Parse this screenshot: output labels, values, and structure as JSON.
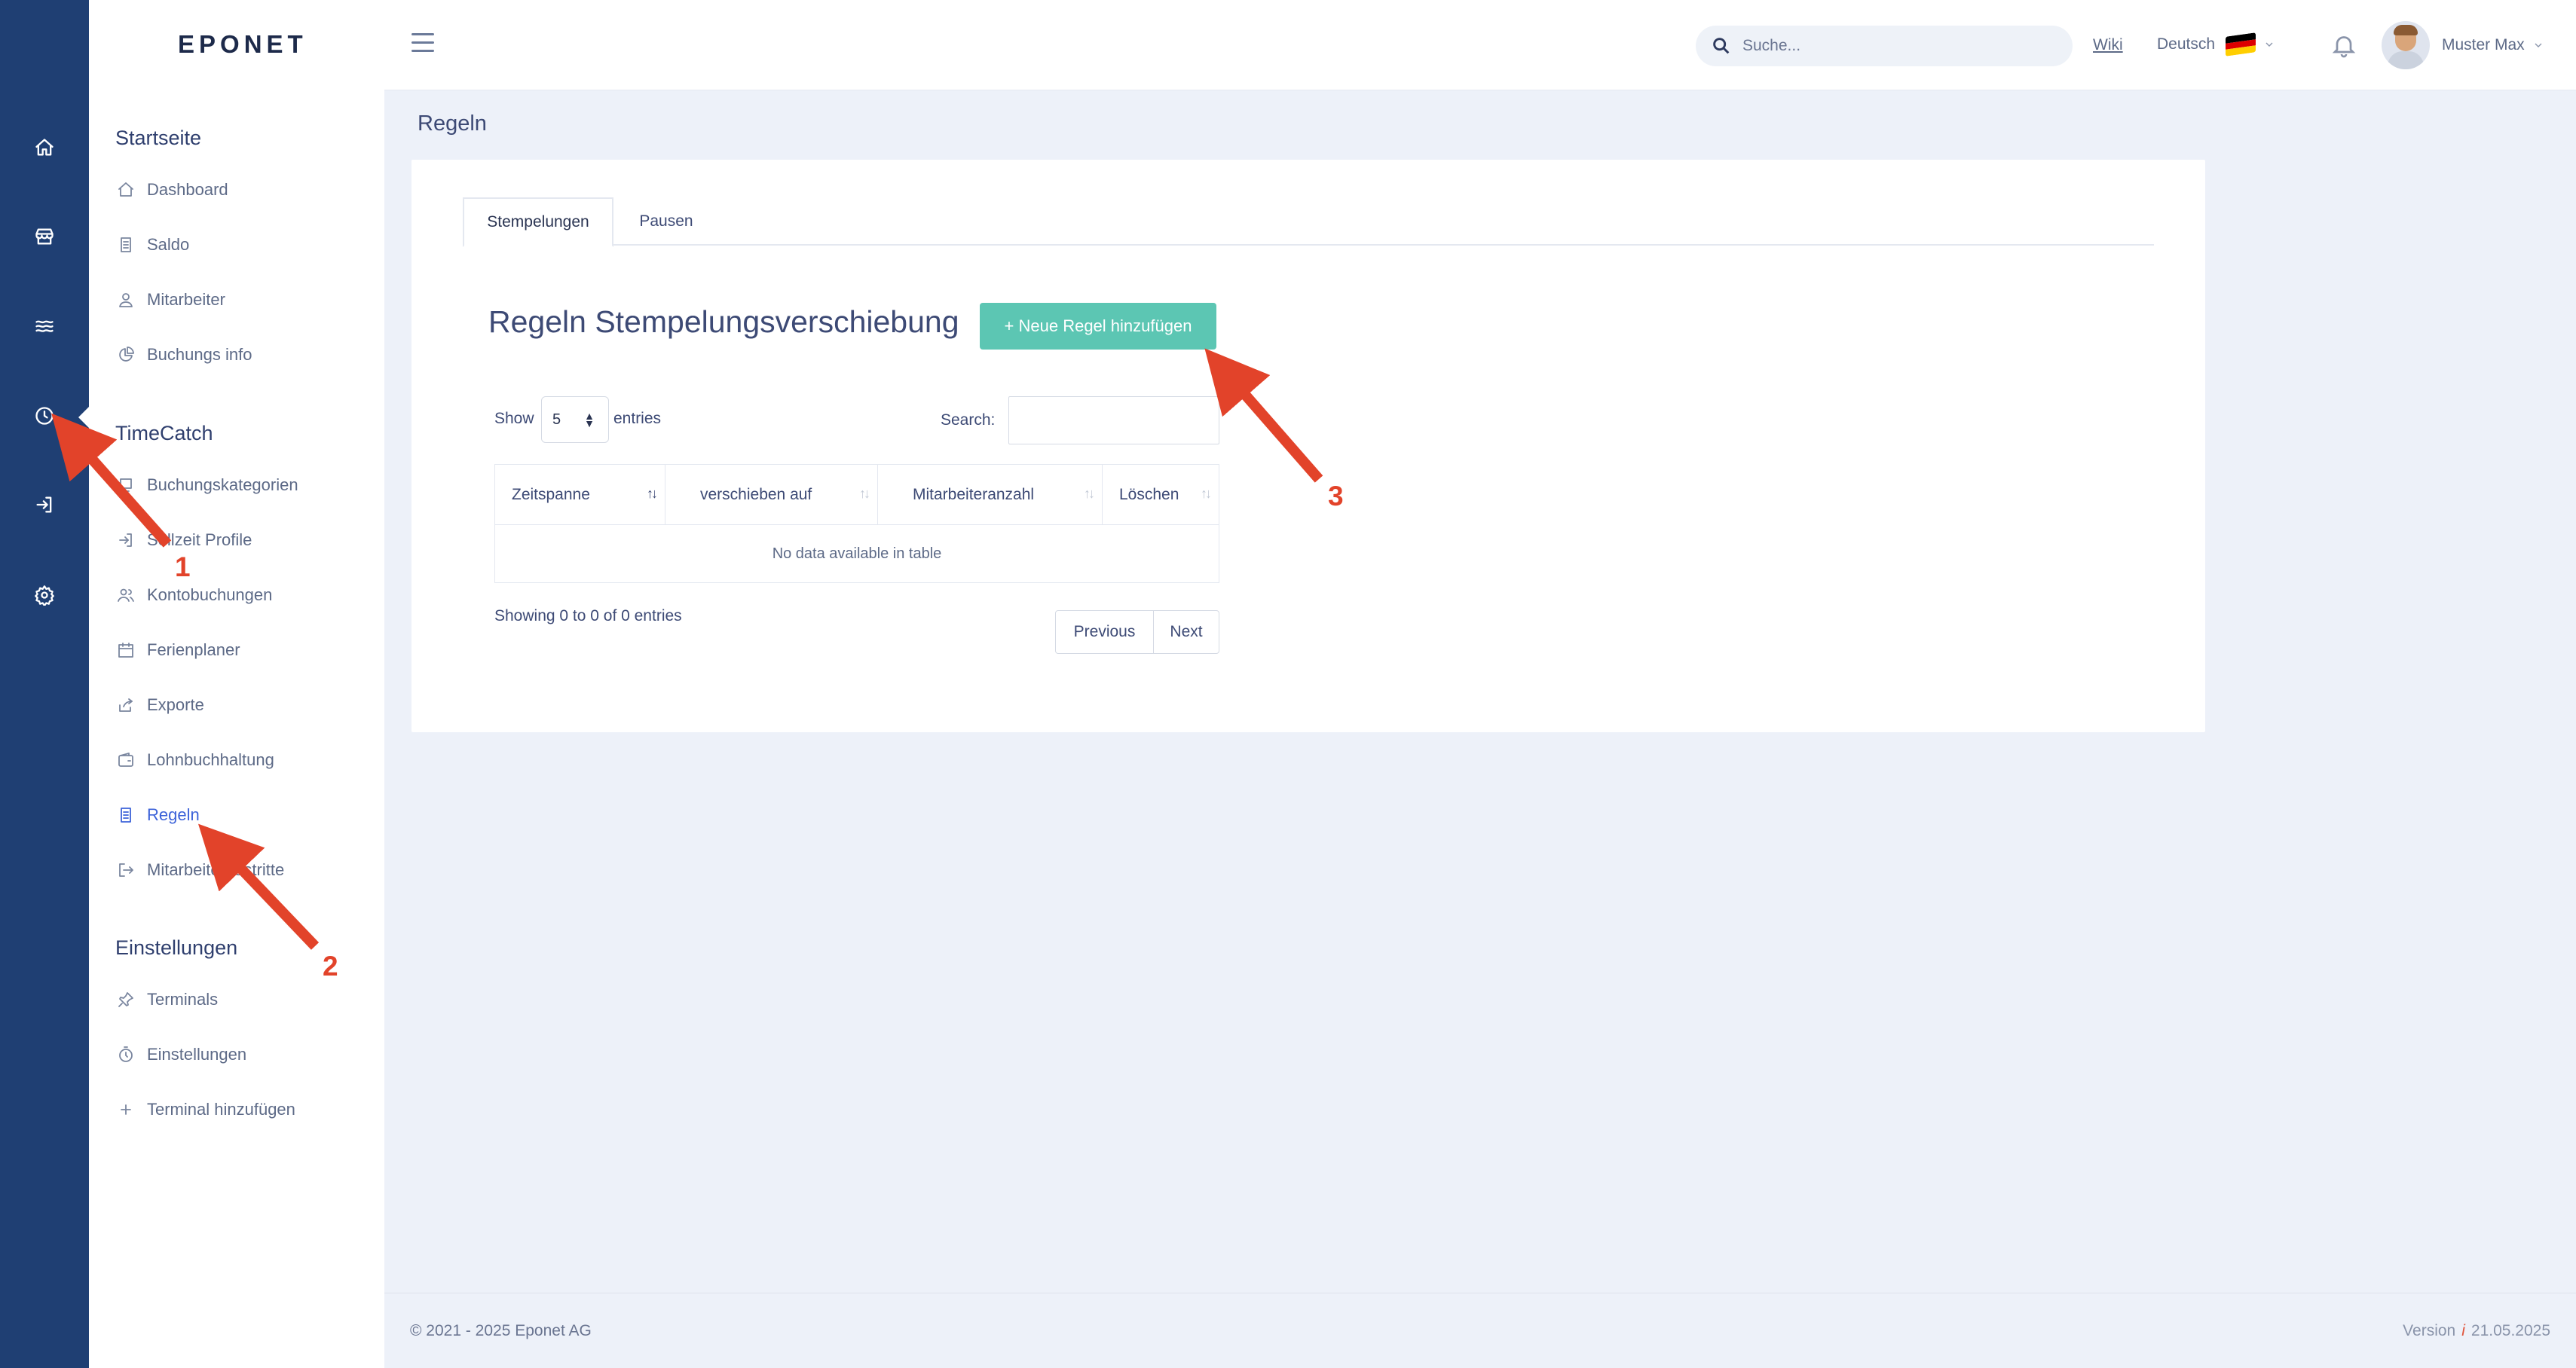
{
  "brand": {
    "logo_text": "EPONET"
  },
  "header": {
    "search_placeholder": "Suche...",
    "wiki_label": "Wiki",
    "language_label": "Deutsch",
    "flag_colors": [
      "#000000",
      "#dd0000",
      "#ffce00"
    ],
    "user_name": "Muster Max"
  },
  "rail": {
    "icons": [
      "home-icon",
      "store-icon",
      "waves-icon",
      "clock-icon",
      "login-icon",
      "gear-icon"
    ]
  },
  "sidebar": {
    "sections": [
      {
        "title": "Startseite",
        "items": [
          {
            "label": "Dashboard",
            "icon": "home-icon"
          },
          {
            "label": "Saldo",
            "icon": "document-icon"
          },
          {
            "label": "Mitarbeiter",
            "icon": "user-icon"
          },
          {
            "label": "Buchungs info",
            "icon": "pie-icon"
          }
        ]
      },
      {
        "title": "TimeCatch",
        "items": [
          {
            "label": "Buchungskategorien",
            "icon": "tag-icon"
          },
          {
            "label": "Sollzeit Profile",
            "icon": "login-icon"
          },
          {
            "label": "Kontobuchungen",
            "icon": "users-icon"
          },
          {
            "label": "Ferienplaner",
            "icon": "calendar-icon"
          },
          {
            "label": "Exporte",
            "icon": "share-icon"
          },
          {
            "label": "Lohnbuchhaltung",
            "icon": "wallet-icon"
          },
          {
            "label": "Regeln",
            "icon": "document-icon",
            "active": true
          },
          {
            "label": "Mitarbeiteraustritte",
            "icon": "logout-icon"
          }
        ]
      },
      {
        "title": "Einstellungen",
        "items": [
          {
            "label": "Terminals",
            "icon": "pin-icon"
          },
          {
            "label": "Einstellungen",
            "icon": "timer-icon"
          },
          {
            "label": "Terminal hinzufügen",
            "icon": "plus-icon"
          }
        ]
      }
    ]
  },
  "main": {
    "page_title": "Regeln",
    "tabs": [
      {
        "label": "Stempelungen",
        "active": true
      },
      {
        "label": "Pausen"
      }
    ],
    "heading": "Regeln Stempelungsverschiebung",
    "add_button": "+ Neue Regel hinzufügen",
    "length": {
      "show": "Show",
      "value": "5",
      "entries": "entries"
    },
    "search_label": "Search:",
    "table": {
      "columns": [
        "Zeitspanne",
        "verschieben auf",
        "Mitarbeiteranzahl",
        "Löschen"
      ],
      "empty": "No data available in table"
    },
    "info": "Showing 0 to 0 of 0 entries",
    "pager": {
      "previous": "Previous",
      "next": "Next"
    }
  },
  "footer": {
    "copyright": "© 2021 - 2025 Eponet AG",
    "version_label": "Version",
    "version_icon": "i",
    "version_date": "21.05.2025"
  },
  "annotations": {
    "color": "#e2432a",
    "labels": [
      "1",
      "2",
      "3"
    ]
  }
}
